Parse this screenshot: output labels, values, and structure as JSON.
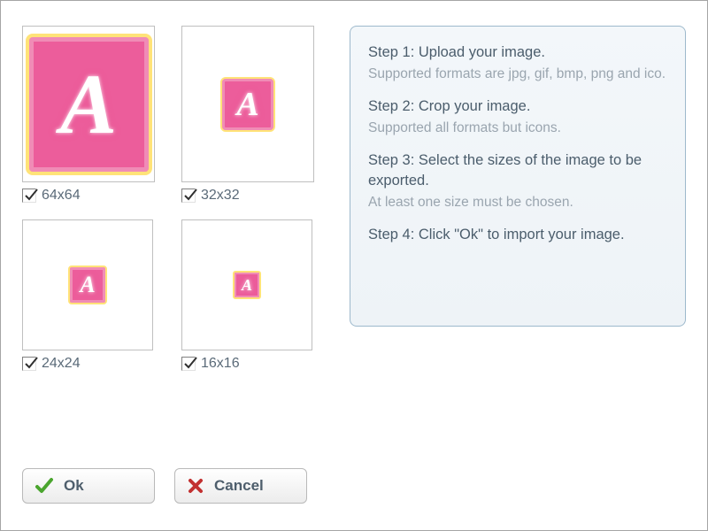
{
  "glyph": "A",
  "previews": [
    {
      "size": "64",
      "label": "64x64",
      "checked": true
    },
    {
      "size": "32",
      "label": "32x32",
      "checked": true
    },
    {
      "size": "24",
      "label": "24x24",
      "checked": true
    },
    {
      "size": "16",
      "label": "16x16",
      "checked": true
    }
  ],
  "steps": {
    "s1_title": "Step 1: Upload your image.",
    "s1_sub": "Supported formats are jpg, gif, bmp, png and ico.",
    "s2_title": "Step 2: Crop your image.",
    "s2_sub": "Supported all formats but icons.",
    "s3_title": "Step 3: Select the sizes of the image to be exported.",
    "s3_sub": "At least one size must be chosen.",
    "s4_title": "Step 4: Click \"Ok\" to import your image."
  },
  "buttons": {
    "ok": "Ok",
    "cancel": "Cancel"
  }
}
